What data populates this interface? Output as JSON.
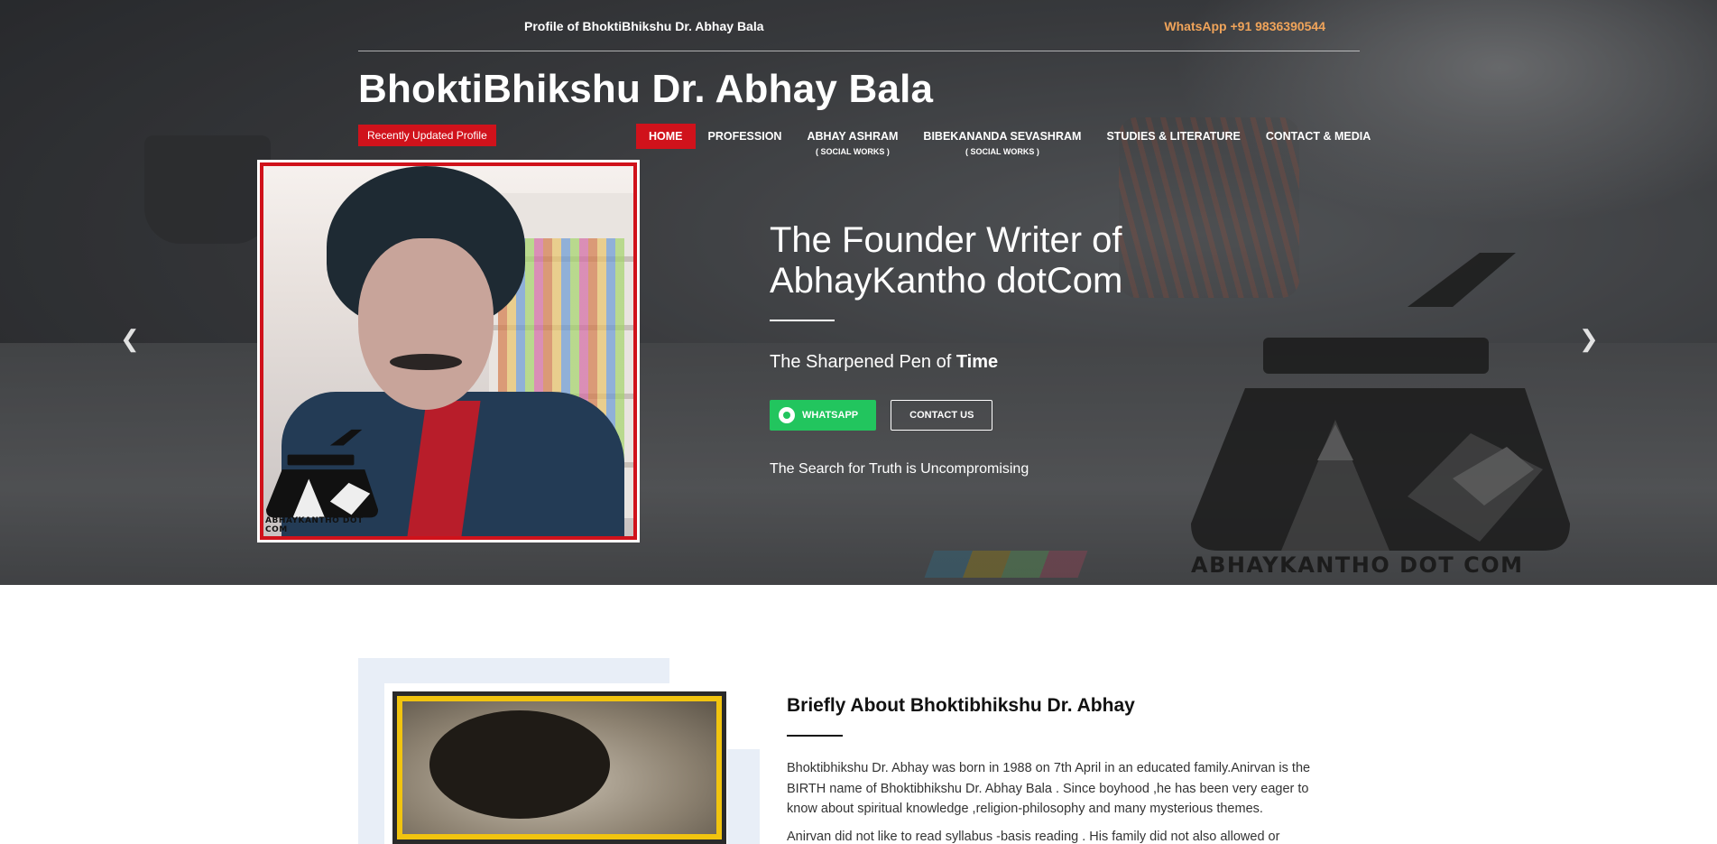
{
  "header": {
    "profile_link": "Profile of BhoktiBhikshu Dr. Abhay Bala",
    "whatsapp_link": "WhatsApp +91 9836390544",
    "site_title": "BhoktiBhikshu Dr. Abhay Bala",
    "updated_badge": "Recently Updated Profile"
  },
  "nav": {
    "items": [
      {
        "label": "HOME",
        "sub": ""
      },
      {
        "label": "PROFESSION",
        "sub": ""
      },
      {
        "label": "ABHAY ASHRAM",
        "sub": "( SOCIAL WORKS )"
      },
      {
        "label": "BIBEKANANDA SEVASHRAM",
        "sub": "( SOCIAL WORKS )"
      },
      {
        "label": "STUDIES & LITERATURE",
        "sub": ""
      },
      {
        "label": "CONTACT & MEDIA",
        "sub": ""
      }
    ],
    "active_index": 0,
    "active_color": "#d0121b"
  },
  "hero": {
    "heading_line1": "The Founder Writer of",
    "heading_line2": "AbhayKantho dotCom",
    "tagline_prefix": "The Sharpened Pen of ",
    "tagline_bold": "Time",
    "whatsapp_button": "WHATSAPP",
    "contact_button": "CONTACT US",
    "search_text": "The Search for Truth is Uncompromising",
    "prev_icon": "chevron-left-icon",
    "next_icon": "chevron-right-icon",
    "portrait_logo_text": "ABHAYKANTHO DOT COM",
    "watermark_text": "ABHAYKANTHO DOT COM",
    "whatsapp_color": "#22c55e"
  },
  "about": {
    "title": "Briefly About Bhoktibhikshu Dr. Abhay",
    "para1": "Bhoktibhikshu Dr. Abhay was born in 1988 on 7th April in an educated family.Anirvan is the BIRTH name of Bhoktibhikshu Dr. Abhay Bala . Since boyhood ,he has been very eager to know about spiritual knowledge ,religion-philosophy and many mysterious themes.",
    "para2": "Anirvan did not like to read syllabus -basis reading . His family did not also allowed or"
  }
}
